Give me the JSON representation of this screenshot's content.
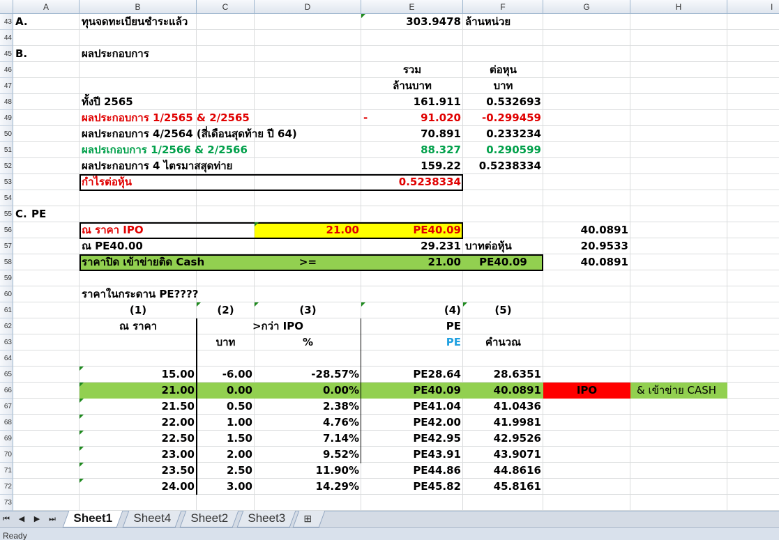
{
  "columns": [
    "A",
    "B",
    "C",
    "D",
    "E",
    "F",
    "G",
    "H",
    "I"
  ],
  "rows": [
    "43",
    "44",
    "45",
    "46",
    "47",
    "48",
    "49",
    "50",
    "51",
    "52",
    "53",
    "54",
    "55",
    "56",
    "57",
    "58",
    "59",
    "60",
    "61",
    "62",
    "63",
    "64",
    "65",
    "66",
    "67",
    "68",
    "69",
    "70",
    "71",
    "72",
    "73"
  ],
  "sectionA": {
    "label": "A.",
    "text": "ทุนจดทะเบียนชำระแล้ว",
    "value": "303.9478",
    "unit": "ล้านหน่วย"
  },
  "sectionB": {
    "label": "B.",
    "text": "ผลประกอบการ",
    "head_total": "รวม",
    "head_per_share": "ต่อหุน",
    "head_unit_total": "ล้านบาท",
    "head_unit_share": "บาท",
    "rows": [
      {
        "label": "ทั้งปี 2565",
        "total": "161.911",
        "per_share": "0.532693",
        "color": "black",
        "sign": ""
      },
      {
        "label": "ผลประกอบการ 1/2565 & 2/2565",
        "total": "91.020",
        "per_share": "-0.299459",
        "color": "red",
        "sign": "-"
      },
      {
        "label": "ผลประกอบการ 4/2564 (สี่เดือนสุดท้าย ปี 64)",
        "total": "70.891",
        "per_share": "0.233234",
        "color": "black",
        "sign": ""
      },
      {
        "label": "ผลปรเกอบการ 1/2566 & 2/2566",
        "total": "88.327",
        "per_share": "0.290599",
        "color": "green",
        "sign": ""
      },
      {
        "label": "ผลประกอบการ 4 ไตรมาสสุดท่าย",
        "total": "159.22",
        "per_share": "0.5238334",
        "color": "black",
        "sign": ""
      }
    ],
    "eps_label": "กำไรต่อหุ้น",
    "eps_value": "0.5238334"
  },
  "sectionC": {
    "label": "C.",
    "title": "PE",
    "ipo_label": "ณ ราคา IPO",
    "ipo_price": "21.00",
    "ipo_pe": "PE40.09",
    "ipo_g": "40.0891",
    "pe40_label": "ณ PE40.00",
    "pe40_value": "29.231",
    "pe40_unit": "บาทต่อหุ้น",
    "pe40_g": "20.9533",
    "close_label": "ราคาปิด เข้าข่ายติด Cash",
    "close_op": ">=",
    "close_price": "21.00",
    "close_pe": "PE40.09",
    "close_g": "40.0891"
  },
  "table": {
    "title": "ราคาในกระดาน PE????",
    "nums": [
      "(1)",
      "(2)",
      "(3)",
      "(4)",
      "(5)"
    ],
    "h1": "ณ ราคา",
    "h3": ">กว่า IPO",
    "h4": "PE",
    "h2b": "บาท",
    "h3b": "%",
    "h4b": "PE",
    "h5b": "คำนวณ",
    "rows": [
      [
        "15.00",
        "-6.00",
        "-28.57%",
        "PE28.64",
        "28.6351"
      ],
      [
        "21.00",
        "0.00",
        "0.00%",
        "PE40.09",
        "40.0891"
      ],
      [
        "21.50",
        "0.50",
        "2.38%",
        "PE41.04",
        "41.0436"
      ],
      [
        "22.00",
        "1.00",
        "4.76%",
        "PE42.00",
        "41.9981"
      ],
      [
        "22.50",
        "1.50",
        "7.14%",
        "PE42.95",
        "42.9526"
      ],
      [
        "23.00",
        "2.00",
        "9.52%",
        "PE43.91",
        "43.9071"
      ],
      [
        "23.50",
        "2.50",
        "11.90%",
        "PE44.86",
        "44.8616"
      ],
      [
        "24.00",
        "3.00",
        "14.29%",
        "PE45.82",
        "45.8161"
      ]
    ],
    "ipo_tag": "IPO",
    "cash_tag": "& เข้าข่าย CASH"
  },
  "tabs": [
    "Sheet1",
    "Sheet4",
    "Sheet2",
    "Sheet3"
  ],
  "active_tab": "Sheet1",
  "status": "Ready",
  "colors": {
    "yellow": "#ffff00",
    "green_fill": "#92d050",
    "red_fill": "#ff0000",
    "red_text": "#e00000",
    "green_text": "#00a04a",
    "blue_text": "#1fa0e0"
  }
}
